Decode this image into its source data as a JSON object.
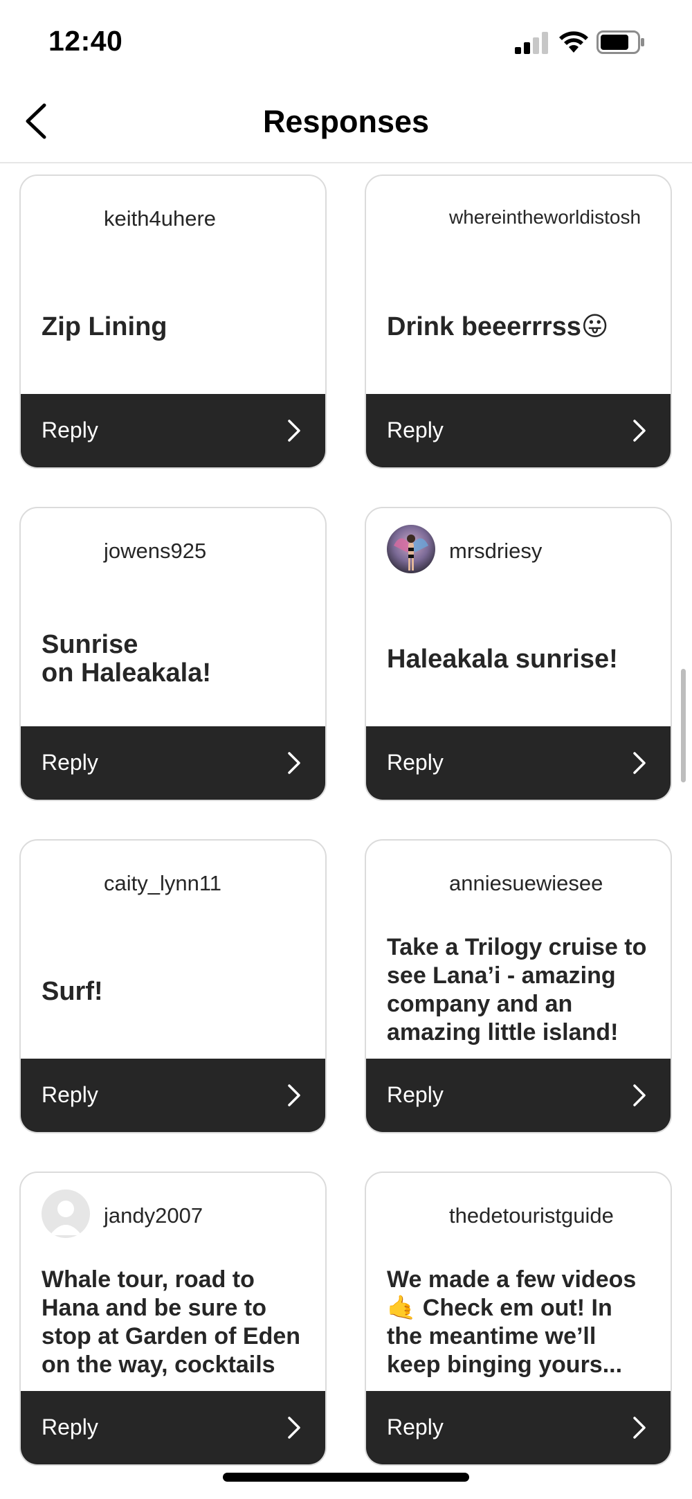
{
  "status": {
    "time": "12:40"
  },
  "nav": {
    "title": "Responses"
  },
  "cards": [
    {
      "user": "keith4uhere",
      "text": "Zip Lining",
      "reply": "Reply"
    },
    {
      "user": "whereintheworldistosh",
      "text": "Drink beeerrrss😛",
      "reply": "Reply"
    },
    {
      "user": "jowens925",
      "text": "Sunrise\non Haleakala!",
      "reply": "Reply"
    },
    {
      "user": "mrsdriesy",
      "text": "Haleakala sunrise!",
      "reply": "Reply"
    },
    {
      "user": "caity_lynn11",
      "text": "Surf!",
      "reply": "Reply"
    },
    {
      "user": "anniesuewiesee",
      "text": "Take a Trilogy cruise to see Lana’i - amazing company and an amazing little island!",
      "reply": "Reply"
    },
    {
      "user": "jandy2007",
      "text": "Whale tour, road to Hana and be sure to stop at Garden of Eden on the way, cocktails",
      "reply": "Reply"
    },
    {
      "user": "thedetouristguide",
      "text": "We made a few videos 🤙 Check em out! In the meantime we’ll keep binging yours...",
      "reply": "Reply"
    }
  ]
}
